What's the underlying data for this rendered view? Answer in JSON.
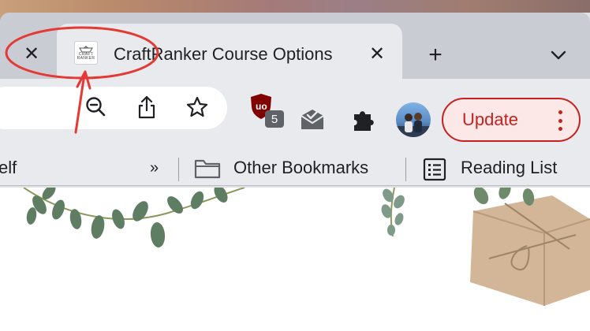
{
  "tabs": {
    "inactive_close": "✕",
    "active": {
      "title": "CraftRanker Course Options",
      "favicon_text_line1": "CRAFT",
      "favicon_text_line2": "RANKER",
      "close": "✕"
    },
    "new_tab": "+",
    "tab_search_icon": "chevron-down-icon"
  },
  "toolbar": {
    "zoom_icon": "zoom-out-icon",
    "share_icon": "share-icon",
    "bookmark_icon": "star-icon",
    "extensions": {
      "ublock_badge": "5",
      "mail_icon": "envelope-check-icon",
      "puzzle_icon": "puzzle-icon"
    },
    "update_label": "Update"
  },
  "bookmarks": {
    "left_partial": "elf",
    "overflow": "»",
    "other_bookmarks": "Other Bookmarks",
    "reading_list": "Reading List"
  },
  "colors": {
    "annotation": "#e53935",
    "update_red": "#c5221f",
    "chrome_bg": "#e8eaed",
    "tabstrip_bg": "#c9ccd3"
  }
}
